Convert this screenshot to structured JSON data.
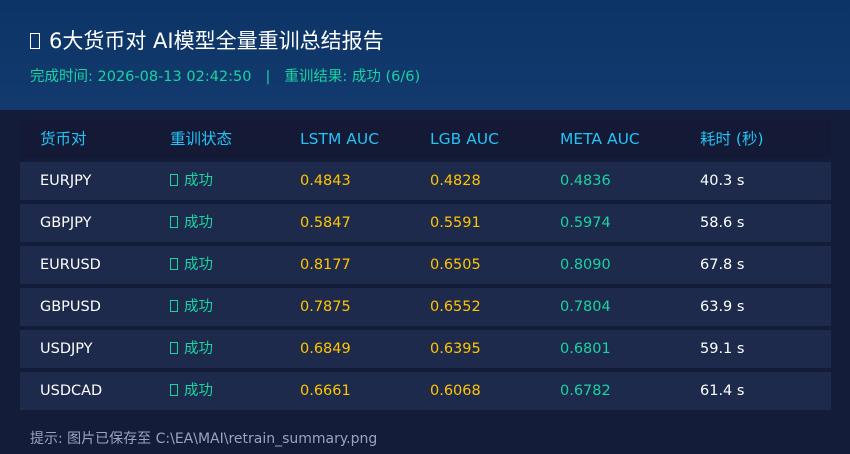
{
  "report": {
    "title": "6大货币对 AI模型全量重训总结报告",
    "title_icon": "missing-glyph-icon",
    "completion_label": "完成时间: 2026-08-13 02:42:50",
    "separator": "|",
    "result_label": "重训结果: 成功 (6/6)"
  },
  "table": {
    "headers": [
      "货币对",
      "重训状态",
      "LSTM AUC",
      "LGB AUC",
      "META AUC",
      "耗时 (秒)"
    ],
    "rows": [
      {
        "pair": "EURJPY",
        "status": "成功",
        "lstm": "0.4843",
        "lgb": "0.4828",
        "meta": "0.4836",
        "time": "40.3 s"
      },
      {
        "pair": "GBPJPY",
        "status": "成功",
        "lstm": "0.5847",
        "lgb": "0.5591",
        "meta": "0.5974",
        "time": "58.6 s"
      },
      {
        "pair": "EURUSD",
        "status": "成功",
        "lstm": "0.8177",
        "lgb": "0.6505",
        "meta": "0.8090",
        "time": "67.8 s"
      },
      {
        "pair": "GBPUSD",
        "status": "成功",
        "lstm": "0.7875",
        "lgb": "0.6552",
        "meta": "0.7804",
        "time": "63.9 s"
      },
      {
        "pair": "USDJPY",
        "status": "成功",
        "lstm": "0.6849",
        "lgb": "0.6395",
        "meta": "0.6801",
        "time": "59.1 s"
      },
      {
        "pair": "USDCAD",
        "status": "成功",
        "lstm": "0.6661",
        "lgb": "0.6068",
        "meta": "0.6782",
        "time": "61.4 s"
      }
    ]
  },
  "footer": {
    "hint": "提示: 图片已保存至 C:\\EA\\MAI\\retrain_summary.png"
  },
  "colors": {
    "accent_header": "#23c3f5",
    "success": "#19d3a0",
    "auc_value": "#ffc400",
    "background": "#131c38",
    "header_band": "#0d3466"
  }
}
